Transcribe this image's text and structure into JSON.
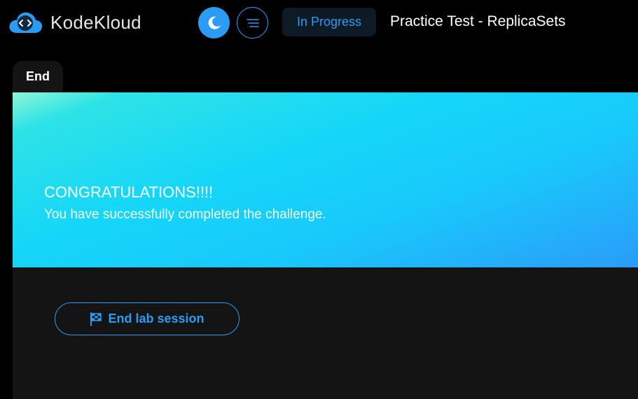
{
  "brand": {
    "name": "KodeKloud"
  },
  "header": {
    "theme_toggle_icon": "moon-icon",
    "menu_icon": "hamburger-menu-icon",
    "status": "In Progress",
    "title": "Practice Test - ReplicaSets"
  },
  "tabs": [
    {
      "label": "End"
    }
  ],
  "banner": {
    "title": "CONGRATULATIONS!!!!",
    "message": "You have successfully completed the challenge."
  },
  "actions": {
    "end_label": "End lab session",
    "end_icon": "checkered-flag-icon"
  },
  "colors": {
    "accent": "#2b9bf4",
    "background": "#000000",
    "panel": "#141414",
    "status_bg": "#0d1b26"
  }
}
